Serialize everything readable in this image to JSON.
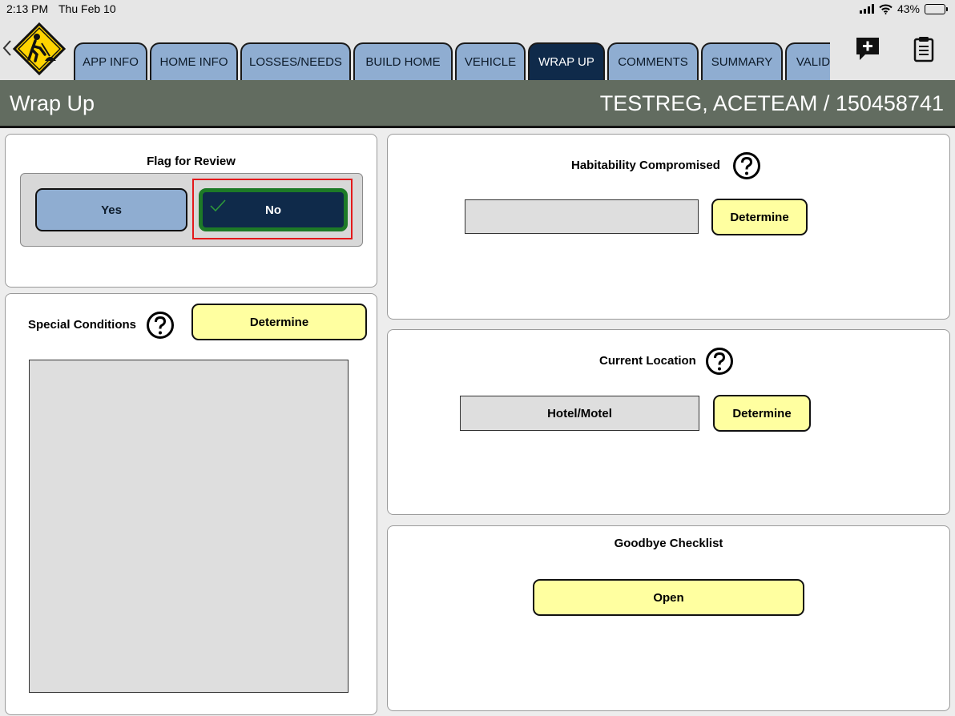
{
  "status_bar": {
    "time": "2:13 PM",
    "date": "Thu Feb 10",
    "battery": "43%",
    "battery_level": 0.43
  },
  "nav": {
    "tabs": [
      {
        "label": "APP INFO",
        "active": false
      },
      {
        "label": "HOME INFO",
        "active": false
      },
      {
        "label": "LOSSES/NEEDS",
        "active": false
      },
      {
        "label": "BUILD HOME",
        "active": false
      },
      {
        "label": "VEHICLE",
        "active": false
      },
      {
        "label": "WRAP UP",
        "active": true
      },
      {
        "label": "COMMENTS",
        "active": false
      },
      {
        "label": "SUMMARY",
        "active": false
      },
      {
        "label": "VALIDA",
        "active": false
      }
    ]
  },
  "header": {
    "title": "Wrap Up",
    "client": "TESTREG, ACETEAM / 150458741"
  },
  "flag_review": {
    "label": "Flag for Review",
    "yes_label": "Yes",
    "no_label": "No",
    "selected": "No"
  },
  "special_conditions": {
    "label": "Special Conditions",
    "determine_label": "Determine",
    "value": ""
  },
  "habitability": {
    "label": "Habitability Compromised",
    "value": "",
    "determine_label": "Determine"
  },
  "current_location": {
    "label": "Current Location",
    "value": "Hotel/Motel",
    "determine_label": "Determine"
  },
  "goodbye_checklist": {
    "label": "Goodbye Checklist",
    "open_label": "Open"
  },
  "colors": {
    "tab_inactive": "#8fadd1",
    "tab_active": "#0f2a4a",
    "title_bar": "#626c60",
    "button_yellow": "#ffffa0",
    "selected_border": "#1d7a27",
    "highlight": "#e3191b"
  },
  "icons": {
    "logo": "construction-worker-sign-icon",
    "back": "chevron-left-icon",
    "comment": "add-comment-icon",
    "clipboard": "clipboard-icon",
    "help": "question-circle-icon",
    "check": "checkmark-icon"
  }
}
